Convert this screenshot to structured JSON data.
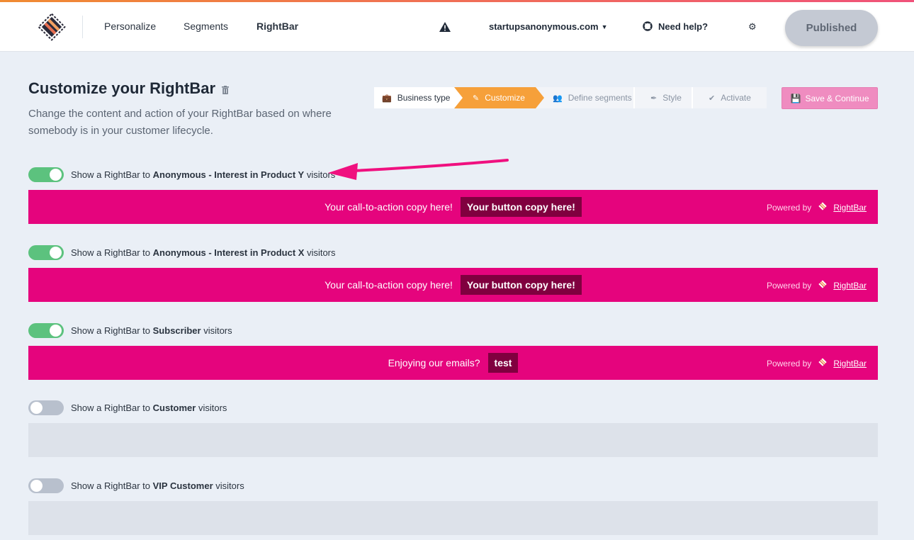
{
  "nav": {
    "items": [
      {
        "label": "Personalize",
        "active": false
      },
      {
        "label": "Segments",
        "active": false
      },
      {
        "label": "RightBar",
        "active": true
      }
    ],
    "domain": "startupsanonymous.com",
    "help_label": "Need help?",
    "published_label": "Published",
    "icons": [
      "logo",
      "warning-icon",
      "chevron-down-icon",
      "lifebuoy-icon",
      "gear-icon"
    ]
  },
  "header": {
    "title": "Customize your RightBar",
    "description": "Change the content and action of your RightBar based on where somebody is in your customer lifecycle."
  },
  "steps": [
    {
      "label": "Business type",
      "icon": "briefcase-icon",
      "state": "done"
    },
    {
      "label": "Customize",
      "icon": "pencil-icon",
      "state": "current"
    },
    {
      "label": "Define segments",
      "icon": "users-icon",
      "state": "upcoming"
    },
    {
      "label": "Style",
      "icon": "brush-icon",
      "state": "upcoming"
    },
    {
      "label": "Activate",
      "icon": "check-icon",
      "state": "upcoming"
    }
  ],
  "save_label": "Save & Continue",
  "rows": [
    {
      "prefix": "Show a RightBar to",
      "segment": "Anonymous - Interest in Product Y",
      "suffix": "visitors",
      "enabled": true,
      "cta_text": "Your call-to-action copy here!",
      "button_text": "Your button copy here!",
      "powered_by": "Powered by",
      "brand": "RightBar"
    },
    {
      "prefix": "Show a RightBar to",
      "segment": "Anonymous - Interest in Product X",
      "suffix": "visitors",
      "enabled": true,
      "cta_text": "Your call-to-action copy here!",
      "button_text": "Your button copy here!",
      "powered_by": "Powered by",
      "brand": "RightBar"
    },
    {
      "prefix": "Show a RightBar to",
      "segment": "Subscriber",
      "suffix": "visitors",
      "enabled": true,
      "cta_text": "Enjoying our emails?",
      "button_text": "test",
      "powered_by": "Powered by",
      "brand": "RightBar"
    },
    {
      "prefix": "Show a RightBar to",
      "segment": "Customer",
      "suffix": "visitors",
      "enabled": false
    },
    {
      "prefix": "Show a RightBar to",
      "segment": "VIP Customer",
      "suffix": "visitors",
      "enabled": false
    }
  ],
  "colors": {
    "bar": "#e5047d",
    "bar_button": "#80003f",
    "toggle_on": "#5cc27e",
    "toggle_off": "#b8c0cd",
    "step_current": "#f6a03a",
    "annotation_arrow": "#f0107f"
  }
}
